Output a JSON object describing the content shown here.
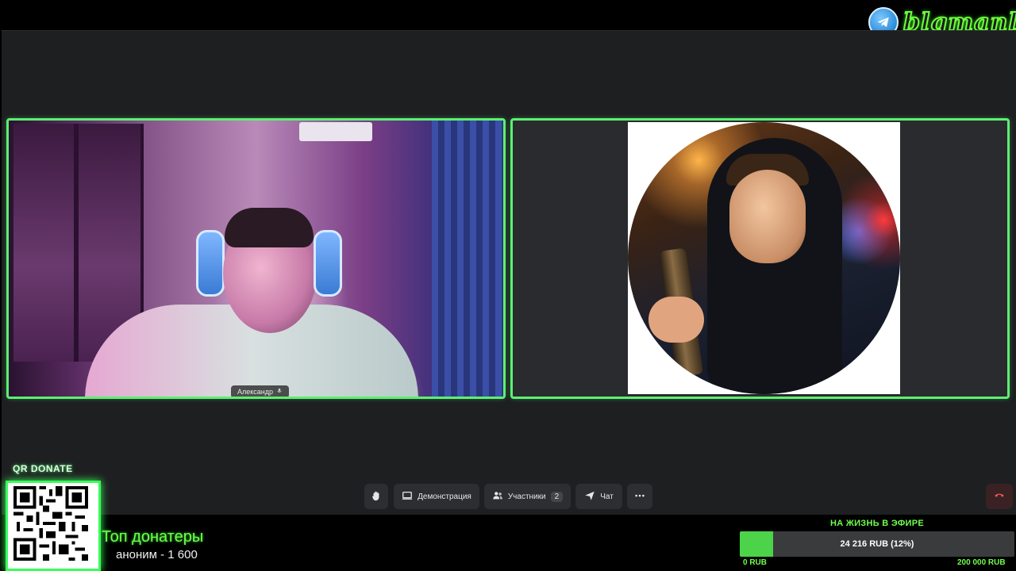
{
  "participants": [
    {
      "name": "Александр",
      "type": "video"
    },
    {
      "name": "",
      "type": "avatar"
    }
  ],
  "controls": {
    "raise_hand": "raise-hand",
    "screen_share_label": "Демонстрация",
    "participants_label": "Участники",
    "participants_count": "2",
    "chat_label": "Чат",
    "more": "more"
  },
  "overlay": {
    "brand": "blgmanlu",
    "qr_title": "QR DONATE",
    "top_donors_title": "Топ донатеры",
    "top_donor_entry": "аноним - 1 600",
    "goal": {
      "title": "НА ЖИЗНЬ В ЭФИРЕ",
      "progress_text": "24 216 RUB (12%)",
      "current": 24216,
      "target": 200000,
      "fraction": 0.12,
      "min_label": "0 RUB",
      "max_label": "200 000 RUB"
    }
  },
  "colors": {
    "accent_green": "#5bf072",
    "stage_bg": "#1e1f21",
    "control_bg": "#2d2e31",
    "goal_fill": "#4dd34a"
  }
}
